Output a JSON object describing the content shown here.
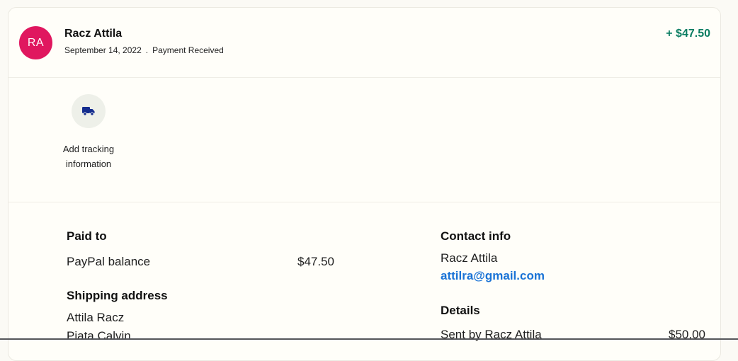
{
  "transaction": {
    "avatar_initials": "RA",
    "name": "Racz Attila",
    "date": "September 14, 2022",
    "separator": ".",
    "status": "Payment Received",
    "amount": "+ $47.50",
    "colors": {
      "avatar": "#e0175f",
      "amount": "#0b7d62",
      "link": "#1a73d6"
    }
  },
  "actions": {
    "tracking_icon": "truck-icon",
    "tracking_label": "Add tracking information"
  },
  "paid_to": {
    "heading": "Paid to",
    "method": "PayPal balance",
    "amount": "$47.50"
  },
  "shipping": {
    "heading": "Shipping address",
    "lines": [
      "Attila Racz",
      "Piata Calvin"
    ]
  },
  "contact": {
    "heading": "Contact info",
    "name": "Racz Attila",
    "email": "attilra@gmail.com"
  },
  "details": {
    "heading": "Details",
    "sent_by_label": "Sent by Racz Attila",
    "sent_by_amount": "$50.00"
  }
}
